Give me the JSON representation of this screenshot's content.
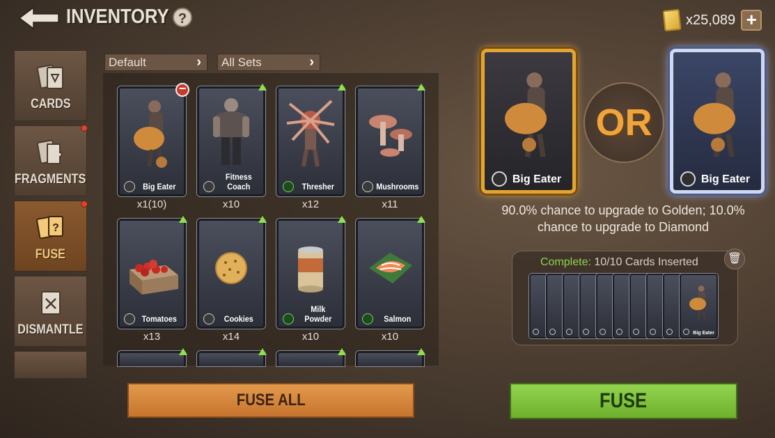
{
  "header": {
    "title": "INVENTORY",
    "help": "?",
    "currency_amount": "x25,089",
    "plus": "+"
  },
  "tabs": [
    {
      "label": "CARDS",
      "active": false,
      "badge": false
    },
    {
      "label": "FRAGMENTS",
      "active": false,
      "badge": true
    },
    {
      "label": "FUSE",
      "active": true,
      "badge": true
    },
    {
      "label": "DISMANTLE",
      "active": false,
      "badge": false
    }
  ],
  "filters": {
    "sort": "Default",
    "set": "All Sets"
  },
  "cards": [
    {
      "name": "Big Eater",
      "qty": "x1(10)",
      "rarity": "gray",
      "remove": true
    },
    {
      "name": "Fitness Coach",
      "qty": "x10",
      "rarity": "gray",
      "upgrade": true
    },
    {
      "name": "Thresher",
      "qty": "x12",
      "rarity": "green",
      "upgrade": true
    },
    {
      "name": "Mushrooms",
      "qty": "x11",
      "rarity": "gray",
      "upgrade": true
    },
    {
      "name": "Tomatoes",
      "qty": "x13",
      "rarity": "gray",
      "upgrade": true
    },
    {
      "name": "Cookies",
      "qty": "x14",
      "rarity": "gray",
      "upgrade": true
    },
    {
      "name": "Milk Powder",
      "qty": "x10",
      "rarity": "green",
      "upgrade": true
    },
    {
      "name": "Salmon",
      "qty": "x10",
      "rarity": "green",
      "upgrade": true
    }
  ],
  "result": {
    "gold_card": "Big Eater",
    "or_text": "OR",
    "diamond_card": "Big Eater",
    "chance_line1": "90.0% chance to upgrade to Golden; 10.0%",
    "chance_line2": "chance to upgrade to Diamond"
  },
  "inserted": {
    "complete_label": "Complete:",
    "complete_value": "10/10 Cards Inserted",
    "last_card_name": "Big Eater",
    "count": 10
  },
  "buttons": {
    "fuse_all": "FUSE ALL",
    "fuse": "FUSE"
  },
  "colors": {
    "gold": "#e3a531",
    "diamond": "#cfd8ef",
    "fuse_green": "#8fd14f",
    "fuse_all_orange": "#d98a40"
  }
}
